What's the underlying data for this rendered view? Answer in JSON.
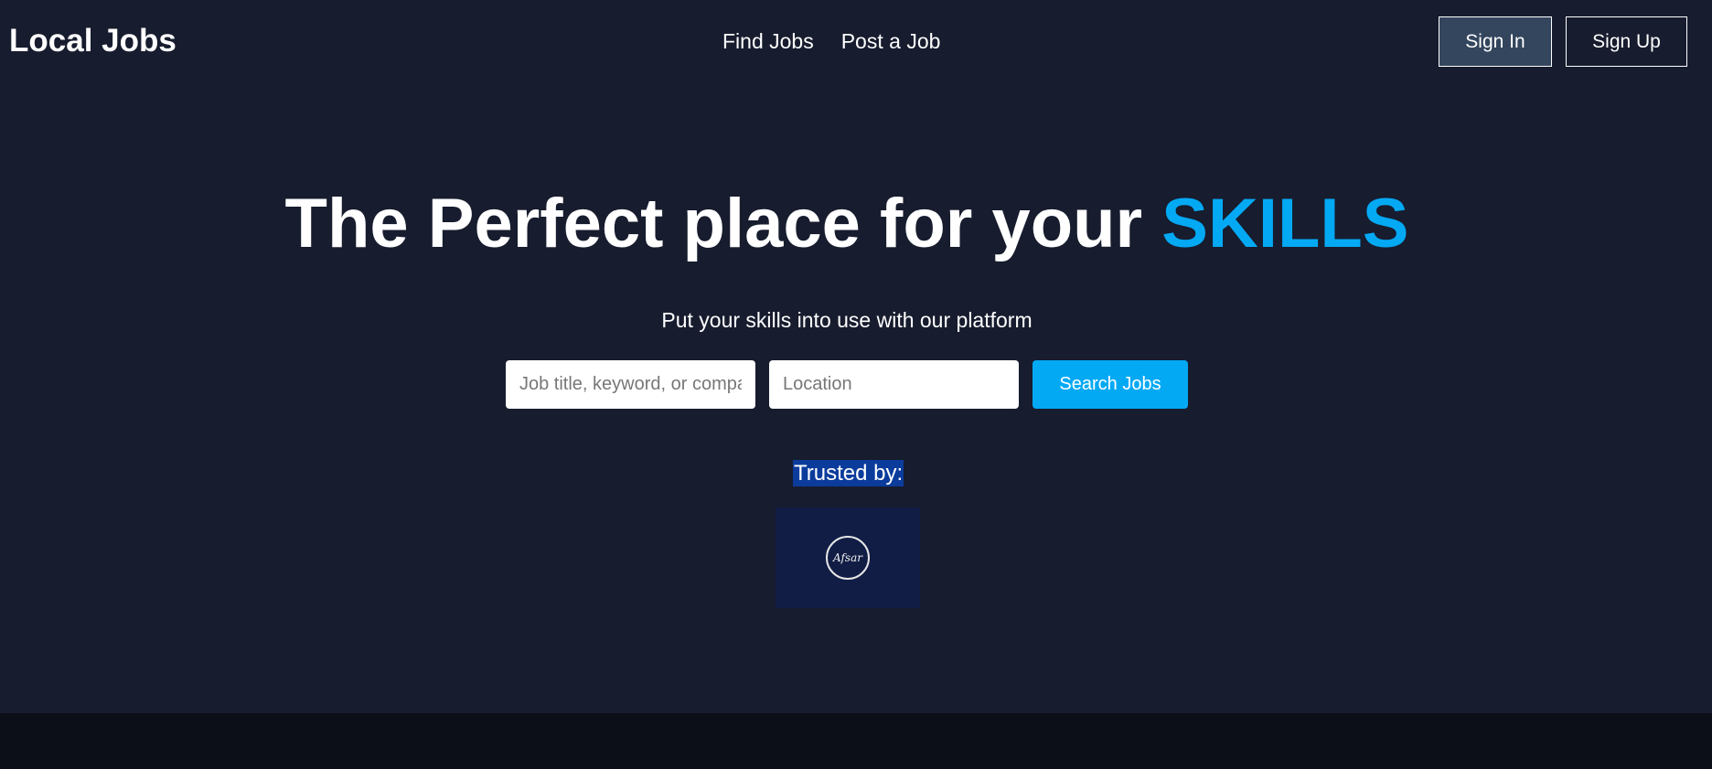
{
  "header": {
    "brand": "Local Jobs",
    "nav": [
      {
        "label": "Find Jobs"
      },
      {
        "label": "Post a Job"
      }
    ],
    "sign_in_label": "Sign In",
    "sign_up_label": "Sign Up"
  },
  "hero": {
    "title_prefix": "The Perfect place for your",
    "title_accent": "SKILLS",
    "subtitle": "Put your skills into use with our platform"
  },
  "search": {
    "keyword_placeholder": "Job title, keyword, or company",
    "location_placeholder": "Location",
    "button_label": "Search Jobs"
  },
  "trusted": {
    "label": "Trusted by:",
    "logos": [
      {
        "text": "Afsar",
        "icon": "circle-signature-logo"
      }
    ]
  },
  "colors": {
    "background": "#171c2e",
    "accent": "#04a9f4",
    "sign_in_bg": "#34465e",
    "trusted_highlight": "#0b3c9c",
    "logo_tile": "#111d45",
    "footer": "#0c0f18"
  }
}
